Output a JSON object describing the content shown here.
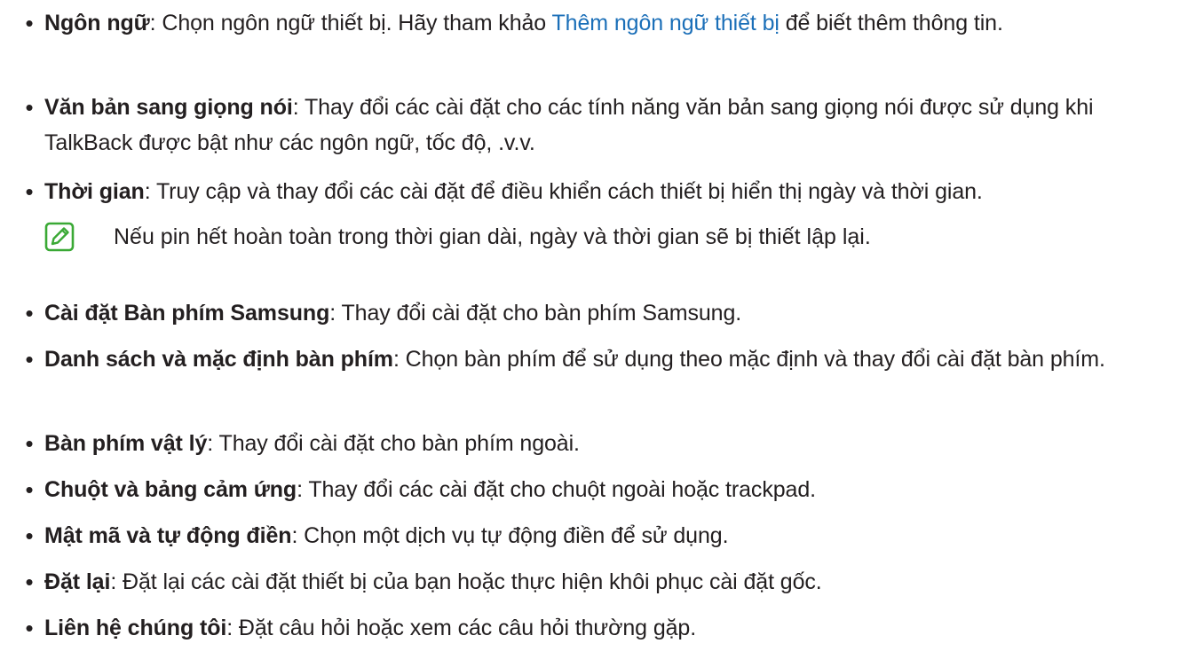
{
  "items": [
    {
      "term": "Ngôn ngữ",
      "desc_before": ": Chọn ngôn ngữ thiết bị. Hãy tham khảo ",
      "link": "Thêm ngôn ngữ thiết bị",
      "desc_after": " để biết thêm thông tin."
    },
    {
      "term": "Văn bản sang giọng nói",
      "desc": ": Thay đổi các cài đặt cho các tính năng văn bản sang giọng nói được sử dụng khi TalkBack được bật như các ngôn ngữ, tốc độ, .v.v."
    },
    {
      "term": "Thời gian",
      "desc": ": Truy cập và thay đổi các cài đặt để điều khiển cách thiết bị hiển thị ngày và thời gian."
    },
    {
      "term": "Cài đặt Bàn phím Samsung",
      "desc": ": Thay đổi cài đặt cho bàn phím Samsung."
    },
    {
      "term": "Danh sách và mặc định bàn phím",
      "desc": ": Chọn bàn phím để sử dụng theo mặc định và thay đổi cài đặt bàn phím."
    },
    {
      "term": "Bàn phím vật lý",
      "desc": ": Thay đổi cài đặt cho bàn phím ngoài."
    },
    {
      "term": "Chuột và bảng cảm ứng",
      "desc": ": Thay đổi các cài đặt cho chuột ngoài hoặc trackpad."
    },
    {
      "term": "Mật mã và tự động điền",
      "desc": ": Chọn một dịch vụ tự động điền để sử dụng."
    },
    {
      "term": "Đặt lại",
      "desc": ": Đặt lại các cài đặt thiết bị của bạn hoặc thực hiện khôi phục cài đặt gốc."
    },
    {
      "term": "Liên hệ chúng tôi",
      "desc": ": Đặt câu hỏi hoặc xem các câu hỏi thường gặp."
    }
  ],
  "note": {
    "icon": "note-pencil-icon",
    "text": "Nếu pin hết hoàn toàn trong thời gian dài, ngày và thời gian sẽ bị thiết lập lại.",
    "color": "#3aa935"
  },
  "colors": {
    "text": "#231f20",
    "link": "#1b6fb8",
    "note_icon": "#3aa935"
  },
  "bullet_glyph": "•"
}
